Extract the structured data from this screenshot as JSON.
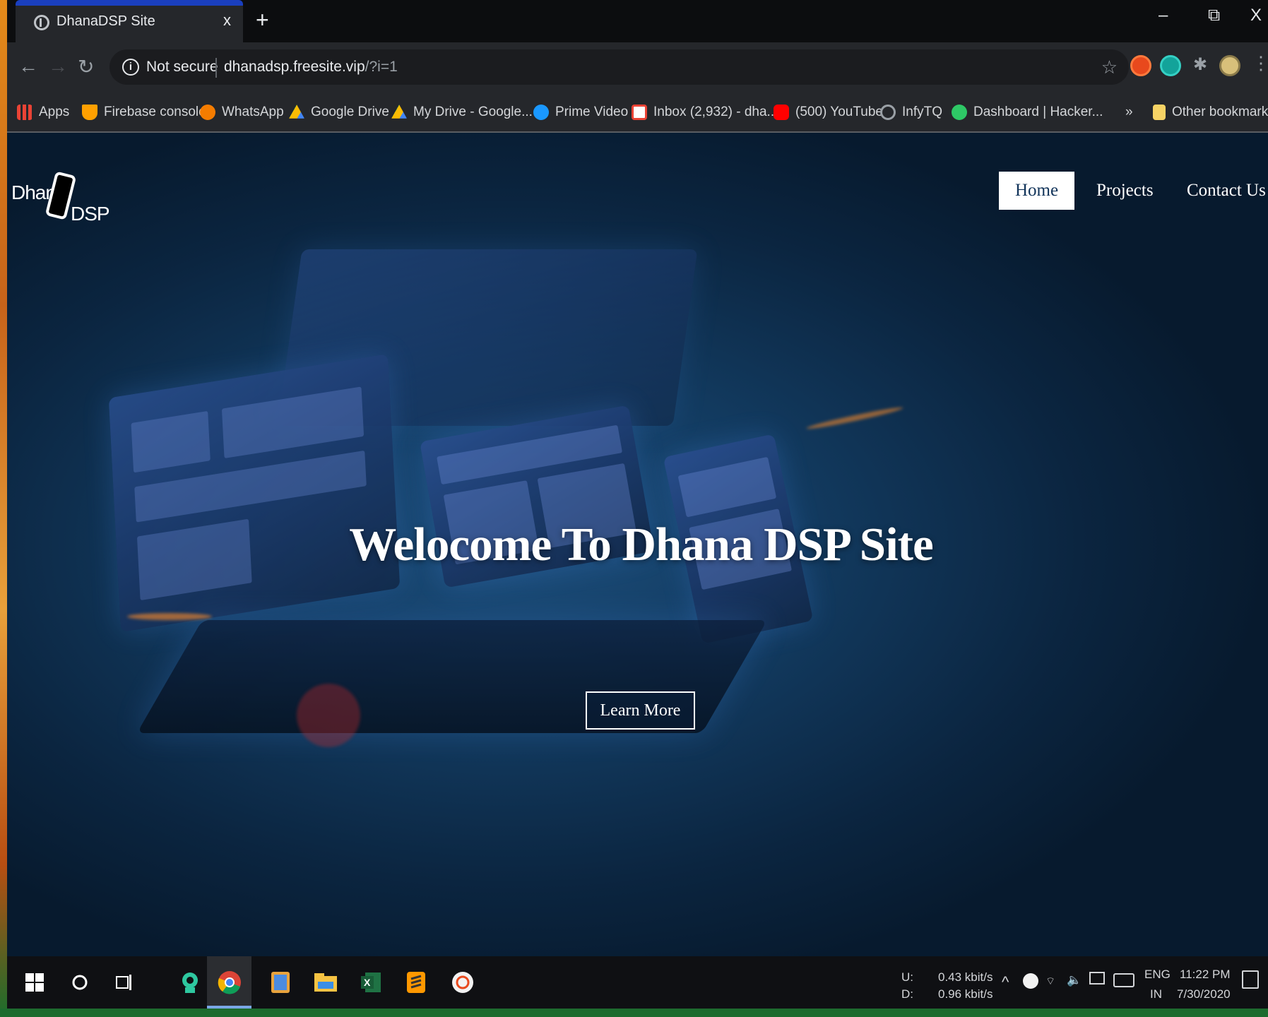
{
  "browser": {
    "tab_title": "DhanaDSP Site",
    "tab_close": "x",
    "new_tab": "+",
    "window_minimize": "–",
    "window_restore": "⧉",
    "window_close": "X",
    "security_label": "Not secure",
    "url_host": "dhanadsp.freesite.vip",
    "url_path": "/?i=1",
    "bookmarks": [
      {
        "label": "Apps",
        "icon": "apps-grid-icon",
        "color": "#ea4335"
      },
      {
        "label": "Firebase console",
        "icon": "firebase-icon",
        "color": "#ffa000"
      },
      {
        "label": "WhatsApp",
        "icon": "whatsapp-icon",
        "color": "#f57c00"
      },
      {
        "label": "Google Drive",
        "icon": "google-drive-icon",
        "color": "#fbbc04"
      },
      {
        "label": "My Drive - Google...",
        "icon": "google-drive-icon",
        "color": "#fbbc04"
      },
      {
        "label": "Prime Video",
        "icon": "prime-video-icon",
        "color": "#1a98ff"
      },
      {
        "label": "Inbox (2,932) - dha...",
        "icon": "gmail-icon",
        "color": "#ea4335"
      },
      {
        "label": "(500) YouTube",
        "icon": "youtube-icon",
        "color": "#ff0000"
      },
      {
        "label": "InfyTQ",
        "icon": "infytq-icon",
        "color": "#9aa0a6"
      },
      {
        "label": "Dashboard | Hacker...",
        "icon": "hackerrank-icon",
        "color": "#2ec866"
      }
    ],
    "bookmarks_overflow": "»",
    "other_bookmarks": "Other bookmarks"
  },
  "site": {
    "logo_word1": "Dhana",
    "logo_word2": "DSP",
    "nav": {
      "home": "Home",
      "projects": "Projects",
      "contact": "Contact Us"
    },
    "hero_title": "Welocome To Dhana DSP Site",
    "cta_label": "Learn More"
  },
  "taskbar": {
    "net_up_label": "U:",
    "net_down_label": "D:",
    "net_up": "0.43 kbit/s",
    "net_down": "0.96 kbit/s",
    "lang_line1": "ENG",
    "lang_line2": "IN",
    "time": "11:22 PM",
    "date": "7/30/2020"
  },
  "colors": {
    "nav_active_bg": "#ffffff",
    "hero_bg": "#0b2540",
    "tab_accent": "#1a3fbf"
  }
}
